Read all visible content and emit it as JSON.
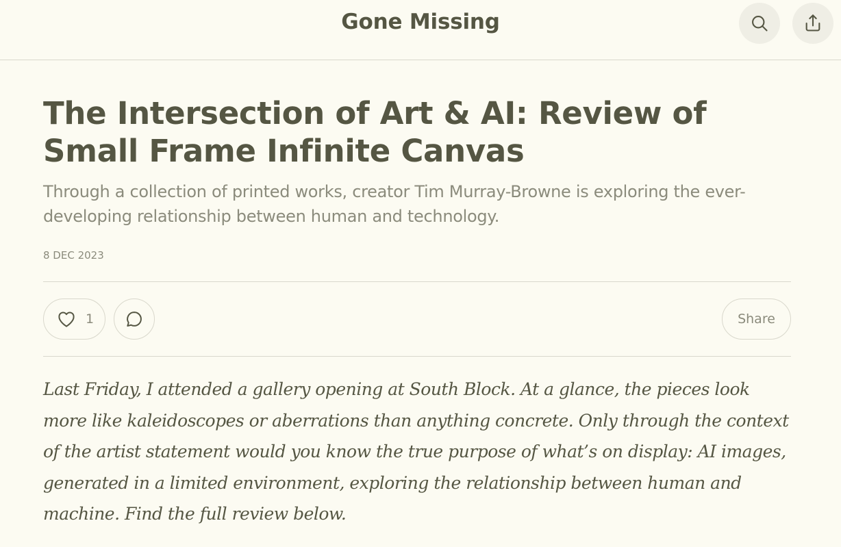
{
  "header": {
    "site_title": "Gone Missing",
    "search_icon": "search-icon",
    "share_icon": "share-upload-icon"
  },
  "post": {
    "title": "The Intersection of Art & AI: Review of Small Frame Infinite Canvas",
    "subtitle": "Through a collection of printed works, creator Tim Murray-Browne is exploring the ever-developing relationship between human and technology.",
    "date": "8 DEC 2023",
    "likes": "1",
    "share_label": "Share",
    "intro": "Last Friday, I attended a gallery opening at South Block. At a glance, the pieces look more like kaleidoscopes or aberrations than anything concrete. Only through the context of the artist statement would you know the true purpose of what’s on display: AI images, generated in a limited environment, exploring the relationship between human and machine. Find the full review below."
  },
  "colors": {
    "background": "#fcfbf2",
    "text": "#555643",
    "muted": "#8b8b7c",
    "border": "#d9d8cc",
    "button_bg": "#efeee5"
  }
}
